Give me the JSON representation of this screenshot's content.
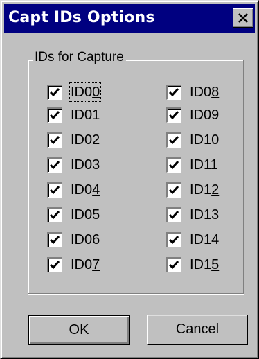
{
  "window": {
    "title": "Capt IDs Options",
    "close_label": "Close"
  },
  "group": {
    "label": "IDs for Capture"
  },
  "checkboxes": [
    {
      "pre": "ID0",
      "mn": "0",
      "post": "",
      "checked": true
    },
    {
      "pre": "ID01",
      "mn": "",
      "post": "",
      "checked": true
    },
    {
      "pre": "ID02",
      "mn": "",
      "post": "",
      "checked": true
    },
    {
      "pre": "ID03",
      "mn": "",
      "post": "",
      "checked": true
    },
    {
      "pre": "ID0",
      "mn": "4",
      "post": "",
      "checked": true
    },
    {
      "pre": "ID05",
      "mn": "",
      "post": "",
      "checked": true
    },
    {
      "pre": "ID06",
      "mn": "",
      "post": "",
      "checked": true
    },
    {
      "pre": "ID0",
      "mn": "7",
      "post": "",
      "checked": true
    },
    {
      "pre": "ID0",
      "mn": "8",
      "post": "",
      "checked": true
    },
    {
      "pre": "ID09",
      "mn": "",
      "post": "",
      "checked": true
    },
    {
      "pre": "ID10",
      "mn": "",
      "post": "",
      "checked": true
    },
    {
      "pre": "ID11",
      "mn": "",
      "post": "",
      "checked": true
    },
    {
      "pre": "ID1",
      "mn": "2",
      "post": "",
      "checked": true
    },
    {
      "pre": "ID13",
      "mn": "",
      "post": "",
      "checked": true
    },
    {
      "pre": "ID14",
      "mn": "",
      "post": "",
      "checked": true
    },
    {
      "pre": "ID1",
      "mn": "5",
      "post": "",
      "checked": true
    }
  ],
  "buttons": {
    "ok_label": "OK",
    "cancel_label": "Cancel"
  },
  "colors": {
    "titlebar": "#000080",
    "face": "#c0c0c0"
  }
}
